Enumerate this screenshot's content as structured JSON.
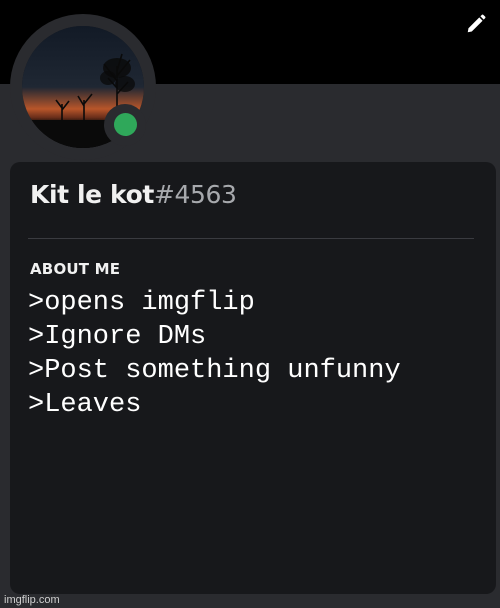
{
  "profile": {
    "username": "Kit le kot",
    "discriminator": "#4563",
    "status_color": "#2fa85a"
  },
  "about": {
    "heading": "ABOUT ME",
    "lines": [
      ">opens imgflip",
      ">Ignore DMs",
      ">Post something unfunny",
      ">Leaves"
    ]
  },
  "header": {
    "edit_icon": "pencil-icon"
  },
  "watermark": "imgflip.com",
  "colors": {
    "banner": "#000000",
    "card_bg": "#17181b",
    "page_bg": "#2a2b2f"
  }
}
